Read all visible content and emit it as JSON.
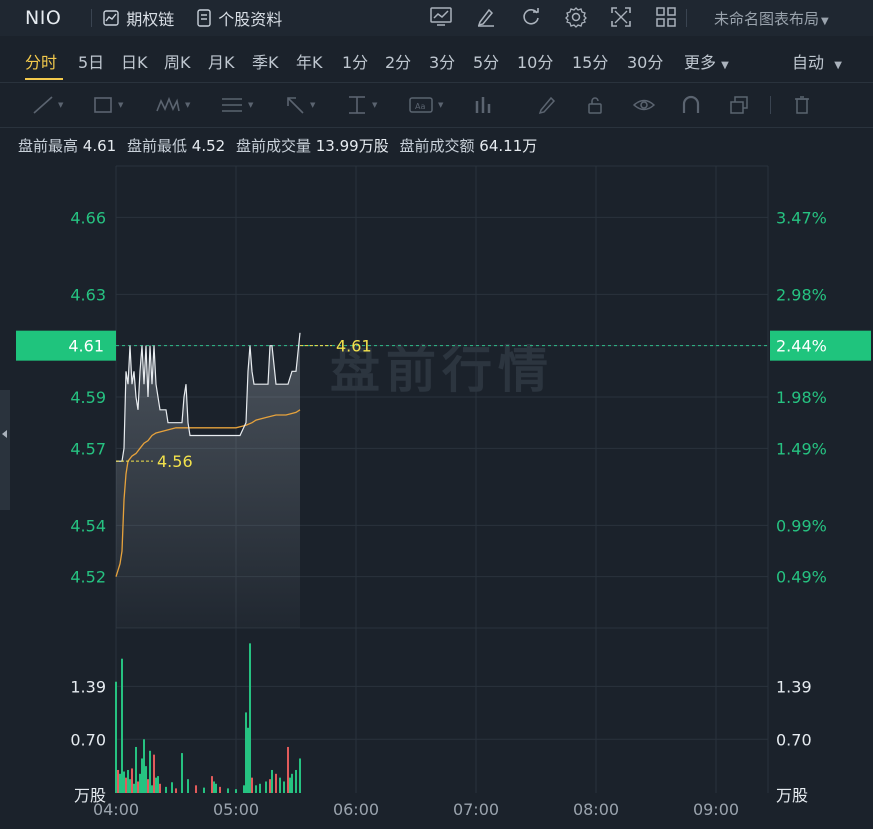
{
  "topbar": {
    "symbol": "NIO",
    "options_chain": "期权链",
    "stock_profile": "个股资料",
    "layout_name": "未命名图表布局"
  },
  "periods": {
    "items": [
      "分时",
      "5日",
      "日K",
      "周K",
      "月K",
      "季K",
      "年K",
      "1分",
      "2分",
      "3分",
      "5分",
      "10分",
      "15分",
      "30分",
      "更多"
    ],
    "active": "分时",
    "scale_mode": "自动"
  },
  "stats": {
    "high_label": "盘前最高",
    "high": "4.61",
    "low_label": "盘前最低",
    "low": "4.52",
    "volume_label": "盘前成交量",
    "volume": "13.99万股",
    "turnover_label": "盘前成交额",
    "turnover": "64.11万"
  },
  "colors": {
    "background": "#1b222b",
    "up": "#26c281",
    "down": "#e25b5b",
    "price_line": "#e8ecf0",
    "avg_line": "#e6a23c",
    "label_yellow": "#f2e14c",
    "badge": "#1fc47d"
  },
  "chart_data": {
    "type": "line",
    "watermark": "盘前行情",
    "x_ticks": [
      "04:00",
      "05:00",
      "06:00",
      "07:00",
      "08:00",
      "09:00"
    ],
    "y_ticks": [
      "4.52",
      "4.54",
      "4.57",
      "4.59",
      "4.61",
      "4.63",
      "4.66"
    ],
    "y_pct_ticks": [
      "0.49%",
      "0.99%",
      "1.49%",
      "1.98%",
      "2.44%",
      "2.98%",
      "3.47%"
    ],
    "ylim": [
      4.5,
      4.68
    ],
    "current_price": "4.61",
    "current_pct": "2.44%",
    "annotation_high": "4.61",
    "annotation_low": "4.56",
    "series": [
      {
        "name": "price",
        "x": [
          0,
          3,
          4,
          5,
          6,
          7,
          8,
          9,
          10,
          11,
          12,
          13,
          14,
          15,
          16,
          17,
          18,
          19,
          20,
          21,
          22,
          23,
          25,
          26,
          27,
          28,
          30,
          33,
          34,
          35,
          36,
          37,
          38,
          40,
          42,
          45,
          48,
          50,
          53,
          58,
          60,
          62,
          65,
          66,
          67,
          68,
          69,
          70,
          71,
          72,
          74,
          75,
          76,
          77,
          78,
          80,
          82,
          84,
          86,
          88,
          90,
          92
        ],
        "y": [
          4.565,
          4.565,
          4.57,
          4.6,
          4.595,
          4.61,
          4.595,
          4.6,
          4.59,
          4.585,
          4.6,
          4.61,
          4.595,
          4.61,
          4.59,
          4.61,
          4.595,
          4.61,
          4.595,
          4.59,
          4.585,
          4.585,
          4.585,
          4.58,
          4.58,
          4.58,
          4.58,
          4.58,
          4.59,
          4.595,
          4.58,
          4.575,
          4.575,
          4.575,
          4.575,
          4.575,
          4.575,
          4.575,
          4.575,
          4.575,
          4.575,
          4.575,
          4.58,
          4.6,
          4.61,
          4.6,
          4.595,
          4.595,
          4.595,
          4.595,
          4.595,
          4.595,
          4.595,
          4.61,
          4.61,
          4.595,
          4.595,
          4.595,
          4.595,
          4.6,
          4.6,
          4.615
        ]
      },
      {
        "name": "average",
        "x": [
          0,
          2,
          3,
          4,
          5,
          6,
          8,
          10,
          12,
          14,
          16,
          18,
          20,
          25,
          30,
          35,
          40,
          45,
          50,
          55,
          60,
          65,
          68,
          70,
          75,
          80,
          85,
          90,
          92
        ],
        "y": [
          4.52,
          4.525,
          4.53,
          4.55,
          4.56,
          4.565,
          4.567,
          4.568,
          4.57,
          4.572,
          4.573,
          4.575,
          4.576,
          4.577,
          4.578,
          4.578,
          4.578,
          4.578,
          4.578,
          4.578,
          4.578,
          4.579,
          4.58,
          4.581,
          4.582,
          4.583,
          4.583,
          4.584,
          4.585
        ]
      }
    ],
    "volume": {
      "unit": "万股",
      "y_ticks": [
        "0.70",
        "1.39"
      ],
      "ylim": [
        0,
        2.15
      ],
      "bars": [
        {
          "x": 0,
          "v": 1.45,
          "up": true
        },
        {
          "x": 1,
          "v": 0.3,
          "up": false
        },
        {
          "x": 2,
          "v": 0.25,
          "up": true
        },
        {
          "x": 3,
          "v": 1.75,
          "up": true
        },
        {
          "x": 4,
          "v": 0.28,
          "up": true
        },
        {
          "x": 5,
          "v": 0.2,
          "up": false
        },
        {
          "x": 6,
          "v": 0.3,
          "up": true
        },
        {
          "x": 7,
          "v": 0.18,
          "up": true
        },
        {
          "x": 8,
          "v": 0.32,
          "up": false
        },
        {
          "x": 9,
          "v": 0.12,
          "up": true
        },
        {
          "x": 10,
          "v": 0.6,
          "up": true
        },
        {
          "x": 11,
          "v": 0.15,
          "up": false
        },
        {
          "x": 12,
          "v": 0.25,
          "up": true
        },
        {
          "x": 13,
          "v": 0.45,
          "up": true
        },
        {
          "x": 14,
          "v": 0.7,
          "up": true
        },
        {
          "x": 15,
          "v": 0.35,
          "up": true
        },
        {
          "x": 16,
          "v": 0.18,
          "up": false
        },
        {
          "x": 17,
          "v": 0.55,
          "up": true
        },
        {
          "x": 18,
          "v": 0.1,
          "up": true
        },
        {
          "x": 19,
          "v": 0.5,
          "up": false
        },
        {
          "x": 20,
          "v": 0.2,
          "up": true
        },
        {
          "x": 21,
          "v": 0.22,
          "up": true
        },
        {
          "x": 22,
          "v": 0.12,
          "up": false
        },
        {
          "x": 25,
          "v": 0.08,
          "up": true
        },
        {
          "x": 28,
          "v": 0.14,
          "up": true
        },
        {
          "x": 30,
          "v": 0.06,
          "up": false
        },
        {
          "x": 33,
          "v": 0.52,
          "up": true
        },
        {
          "x": 36,
          "v": 0.18,
          "up": true
        },
        {
          "x": 40,
          "v": 0.1,
          "up": false
        },
        {
          "x": 44,
          "v": 0.07,
          "up": true
        },
        {
          "x": 48,
          "v": 0.22,
          "up": false
        },
        {
          "x": 49,
          "v": 0.15,
          "up": true
        },
        {
          "x": 50,
          "v": 0.12,
          "up": true
        },
        {
          "x": 52,
          "v": 0.08,
          "up": false
        },
        {
          "x": 56,
          "v": 0.06,
          "up": true
        },
        {
          "x": 60,
          "v": 0.05,
          "up": true
        },
        {
          "x": 64,
          "v": 0.1,
          "up": true
        },
        {
          "x": 65,
          "v": 1.05,
          "up": true
        },
        {
          "x": 66,
          "v": 0.85,
          "up": true
        },
        {
          "x": 67,
          "v": 1.95,
          "up": true
        },
        {
          "x": 68,
          "v": 0.2,
          "up": false
        },
        {
          "x": 70,
          "v": 0.1,
          "up": true
        },
        {
          "x": 72,
          "v": 0.12,
          "up": true
        },
        {
          "x": 75,
          "v": 0.15,
          "up": true
        },
        {
          "x": 77,
          "v": 0.18,
          "up": false
        },
        {
          "x": 78,
          "v": 0.3,
          "up": true
        },
        {
          "x": 80,
          "v": 0.25,
          "up": false
        },
        {
          "x": 82,
          "v": 0.2,
          "up": true
        },
        {
          "x": 84,
          "v": 0.15,
          "up": true
        },
        {
          "x": 86,
          "v": 0.6,
          "up": false
        },
        {
          "x": 87,
          "v": 0.2,
          "up": true
        },
        {
          "x": 88,
          "v": 0.25,
          "up": true
        },
        {
          "x": 90,
          "v": 0.3,
          "up": true
        },
        {
          "x": 92,
          "v": 0.45,
          "up": true
        }
      ]
    }
  }
}
